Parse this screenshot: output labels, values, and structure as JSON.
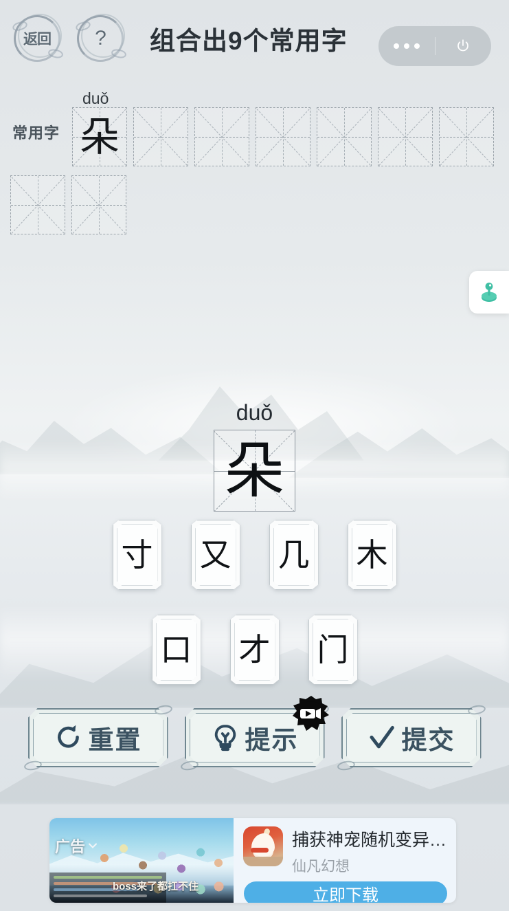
{
  "header": {
    "back_label": "返回",
    "help_label": "?",
    "title": "组合出9个常用字",
    "capsule": {
      "more_icon": "more-dots-icon",
      "power_icon": "power-icon"
    }
  },
  "answer_area": {
    "label": "常用字",
    "pinyin": "duǒ",
    "row1": [
      {
        "char": "朵",
        "filled": true
      },
      {
        "char": "",
        "filled": false
      },
      {
        "char": "",
        "filled": false
      },
      {
        "char": "",
        "filled": false
      },
      {
        "char": "",
        "filled": false
      },
      {
        "char": "",
        "filled": false
      },
      {
        "char": "",
        "filled": false
      }
    ],
    "row2": [
      {
        "char": "",
        "filled": false
      },
      {
        "char": "",
        "filled": false
      }
    ],
    "total_count": 9
  },
  "side_float": {
    "icon": "joystick-icon",
    "color": "#3fbfa4"
  },
  "target": {
    "pinyin": "duǒ",
    "char": "朵"
  },
  "tiles": {
    "row1": [
      "寸",
      "又",
      "几",
      "木"
    ],
    "row2": [
      "口",
      "才",
      "门"
    ]
  },
  "actions": [
    {
      "label": "重置",
      "icon": "refresh-icon"
    },
    {
      "label": "提示",
      "icon": "lightbulb-icon",
      "badge": "video-ad-icon"
    },
    {
      "label": "提交",
      "icon": "check-icon"
    }
  ],
  "ad": {
    "tag": "广告",
    "tag_chevron": "chevron-down-icon",
    "thumb_caption": "boss来了都扛不住",
    "title": "捕获神宠随机变异，…",
    "subtitle": "仙凡幻想",
    "cta": "立即下载",
    "cta_color": "#4eafe6"
  },
  "colors": {
    "background": "#dfe3e6",
    "title_text": "#2b3238",
    "action_text": "#3b5261",
    "accent_teal": "#3fbfa4"
  }
}
